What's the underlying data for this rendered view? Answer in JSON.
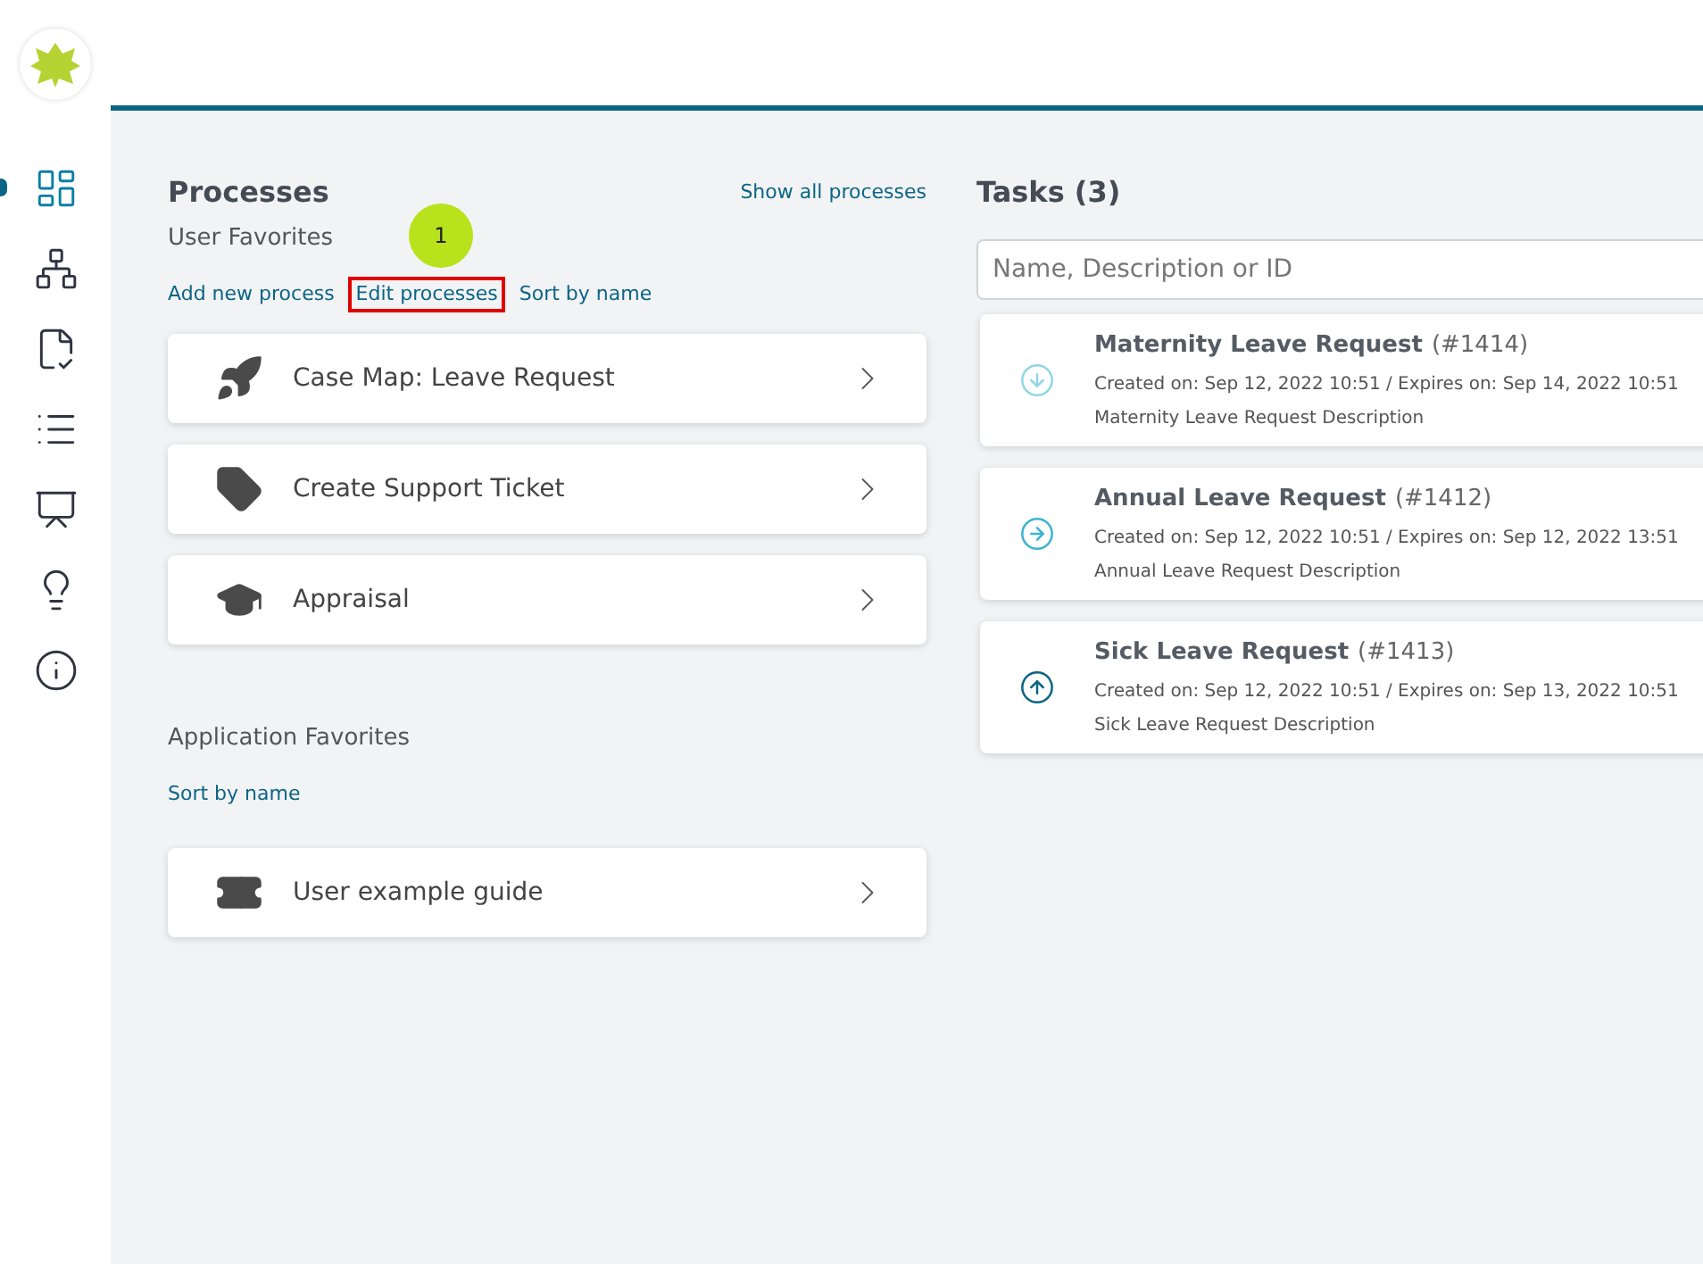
{
  "sidebar": {
    "items": [
      {
        "kind": "dashboard",
        "selected": true
      },
      {
        "kind": "flow",
        "selected": false
      },
      {
        "kind": "form",
        "selected": false
      },
      {
        "kind": "list",
        "selected": false
      },
      {
        "kind": "report",
        "selected": false
      },
      {
        "kind": "idea",
        "selected": false
      },
      {
        "kind": "info",
        "selected": false
      }
    ]
  },
  "processes": {
    "title": "Processes",
    "show_all": "Show all processes",
    "user_favorites": {
      "title": "User Favorites",
      "actions": [
        {
          "label": "Add new process",
          "highlighted": false
        },
        {
          "label": "Edit processes",
          "highlighted": true
        },
        {
          "label": "Sort by name",
          "highlighted": false
        }
      ],
      "items": [
        {
          "kind": "rocket",
          "label": "Case Map: Leave Request"
        },
        {
          "kind": "tag",
          "label": "Create Support Ticket"
        },
        {
          "kind": "graduation",
          "label": "Appraisal"
        }
      ]
    },
    "application_favorites": {
      "title": "Application Favorites",
      "actions": [
        {
          "label": "Sort by name",
          "highlighted": false
        }
      ],
      "items": [
        {
          "kind": "ticket",
          "label": "User example guide"
        }
      ]
    }
  },
  "annotation": {
    "label": "1"
  },
  "tasks": {
    "title": "Tasks (3)",
    "search": {
      "placeholder": "Name, Description or ID"
    },
    "items": [
      {
        "kind": "down",
        "name": "Maternity Leave Request",
        "id": "(#1414)",
        "dates": "Created on: Sep 12, 2022 10:51 / Expires on: Sep 14, 2022 10:51",
        "description": "Maternity Leave Request Description"
      },
      {
        "kind": "right",
        "name": "Annual Leave Request",
        "id": "(#1412)",
        "dates": "Created on: Sep 12, 2022 10:51 / Expires on: Sep 12, 2022 13:51",
        "description": "Annual Leave Request Description"
      },
      {
        "kind": "up",
        "name": "Sick Leave Request",
        "id": "(#1413)",
        "dates": "Created on: Sep 12, 2022 10:51 / Expires on: Sep 13, 2022 10:51",
        "description": "Sick Leave Request Description"
      }
    ]
  }
}
